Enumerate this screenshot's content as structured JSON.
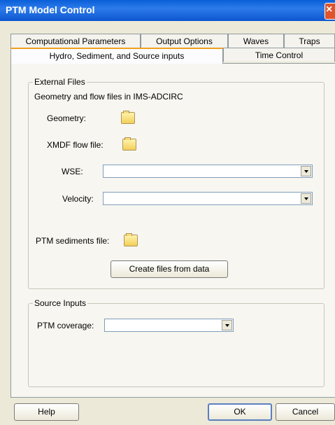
{
  "window": {
    "title": "PTM Model Control"
  },
  "tabs": {
    "back_row": [
      "Computational Parameters",
      "Output Options",
      "Waves",
      "Traps"
    ],
    "front_row": [
      "Hydro, Sediment, and Source inputs",
      "Time Control"
    ],
    "active": "Hydro, Sediment, and Source inputs"
  },
  "external_files": {
    "title": "External Files",
    "description": "Geometry and flow files in IMS-ADCIRC",
    "geometry_label": "Geometry:",
    "xmdf_label": "XMDF flow file:",
    "wse_label": "WSE:",
    "wse_value": "",
    "velocity_label": "Velocity:",
    "velocity_value": "",
    "sediments_label": "PTM sediments file:",
    "create_button": "Create files from data"
  },
  "source_inputs": {
    "title": "Source Inputs",
    "coverage_label": "PTM coverage:",
    "coverage_value": ""
  },
  "footer": {
    "help": "Help",
    "ok": "OK",
    "cancel": "Cancel"
  }
}
